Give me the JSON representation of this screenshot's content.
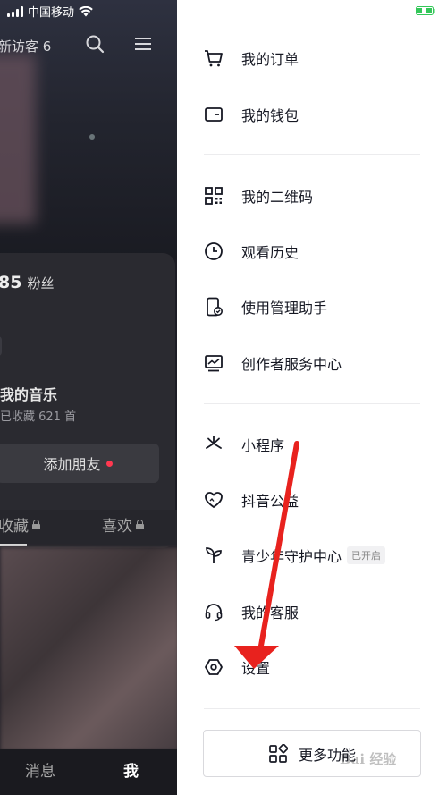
{
  "status_bar": {
    "carrier": "中国移动"
  },
  "background": {
    "header": {
      "visitors_text": "新访客 6"
    },
    "profile_card": {
      "fans_count": "85",
      "fans_label": "粉丝",
      "music_title": "我的音乐",
      "music_subtitle": "已收藏 621 首",
      "add_friend_label": "添加朋友"
    },
    "tabs": [
      {
        "label": "收藏",
        "locked": true
      },
      {
        "label": "喜欢",
        "locked": true
      }
    ],
    "bottom_nav": {
      "messages": "消息",
      "me": "我"
    }
  },
  "drawer": {
    "groups": [
      [
        {
          "label": "我的订单",
          "icon": "cart-icon"
        },
        {
          "label": "我的钱包",
          "icon": "wallet-icon"
        }
      ],
      [
        {
          "label": "我的二维码",
          "icon": "qrcode-icon"
        },
        {
          "label": "观看历史",
          "icon": "clock-icon"
        },
        {
          "label": "使用管理助手",
          "icon": "phone-check-icon"
        },
        {
          "label": "创作者服务中心",
          "icon": "chart-monitor-icon"
        }
      ],
      [
        {
          "label": "小程序",
          "icon": "asterisk-icon"
        },
        {
          "label": "抖音公益",
          "icon": "heart-hand-icon"
        },
        {
          "label": "青少年守护中心",
          "icon": "sprout-icon",
          "badge": "已开启"
        },
        {
          "label": "我的客服",
          "icon": "headset-icon"
        },
        {
          "label": "设置",
          "icon": "hexagon-gear-icon"
        }
      ]
    ],
    "more_button": {
      "label": "更多功能",
      "icon": "grid-apps-icon"
    }
  },
  "watermark": "Bai 经验",
  "colors": {
    "annotation_arrow": "#e8221e",
    "drawer_text": "#161823",
    "notification_dot": "#ff3850",
    "battery": "#34c759"
  }
}
